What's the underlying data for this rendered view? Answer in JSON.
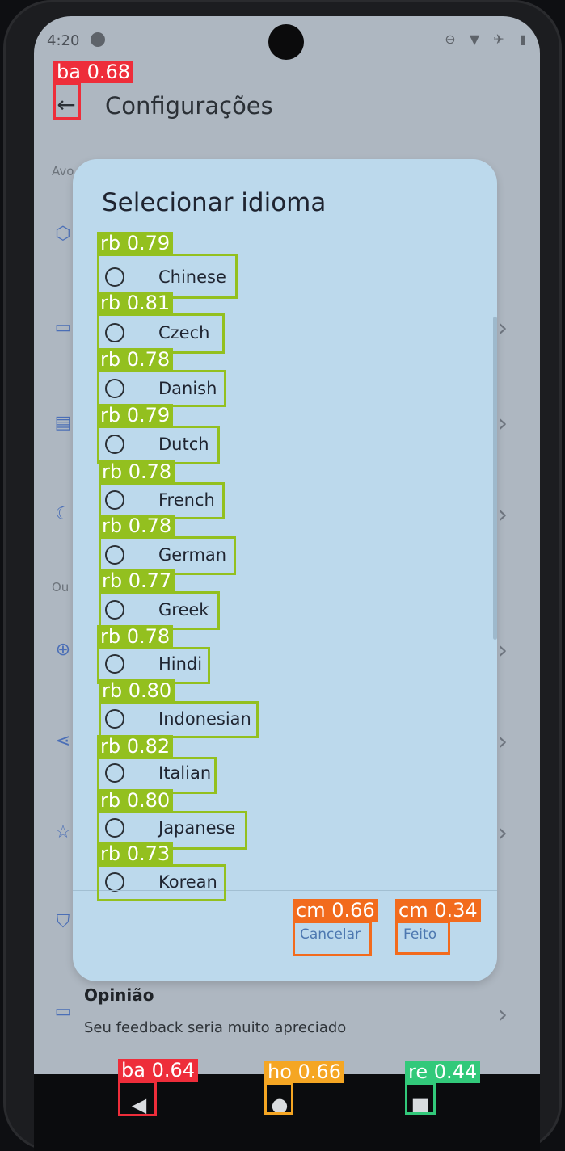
{
  "status_bar": {
    "time": "4:20"
  },
  "app_bar": {
    "back_icon": "arrow-left-icon",
    "title": "Configurações"
  },
  "background": {
    "section_1": "Avo",
    "section_2": "Ou",
    "feedback": {
      "title": "Opinião",
      "subtitle": "Seu feedback seria muito apreciado"
    }
  },
  "dialog": {
    "title": "Selecionar idioma",
    "options": [
      "Chinese",
      "Czech",
      "Danish",
      "Dutch",
      "French",
      "German",
      "Greek",
      "Hindi",
      "Indonesian",
      "Italian",
      "Japanese",
      "Korean"
    ],
    "cancel_label": "Cancelar",
    "done_label": "Feito"
  },
  "annotations": [
    {
      "label": "ba 0.68",
      "color": "#ee2d3a"
    },
    {
      "label": "rb 0.79",
      "color": "#93c01f"
    },
    {
      "label": "rb 0.81",
      "color": "#93c01f"
    },
    {
      "label": "rb 0.78",
      "color": "#93c01f"
    },
    {
      "label": "rb 0.79",
      "color": "#93c01f"
    },
    {
      "label": "rb 0.78",
      "color": "#93c01f"
    },
    {
      "label": "rb 0.78",
      "color": "#93c01f"
    },
    {
      "label": "rb 0.77",
      "color": "#93c01f"
    },
    {
      "label": "rb 0.78",
      "color": "#93c01f"
    },
    {
      "label": "rb 0.80",
      "color": "#93c01f"
    },
    {
      "label": "rb 0.82",
      "color": "#93c01f"
    },
    {
      "label": "rb 0.80",
      "color": "#93c01f"
    },
    {
      "label": "rb 0.73",
      "color": "#93c01f"
    },
    {
      "label": "cm 0.66",
      "color": "#f26b1d"
    },
    {
      "label": "cm 0.34",
      "color": "#f26b1d"
    },
    {
      "label": "ba 0.64",
      "color": "#ee2d3a"
    },
    {
      "label": "ho 0.66",
      "color": "#f5a623"
    },
    {
      "label": "re 0.44",
      "color": "#32c97a"
    }
  ],
  "colors": {
    "dialog_bg": "#bcd9ec",
    "accent": "#4d78b0",
    "screen_dim": "#aeb7c1"
  }
}
